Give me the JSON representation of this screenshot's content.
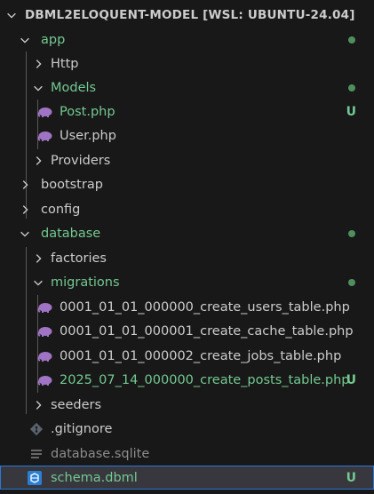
{
  "explorer": {
    "root_label": "DBML2ELOQUENT-MODEL [WSL: UBUNTU-24.04]"
  },
  "tree": {
    "app": "app",
    "http": "Http",
    "models": "Models",
    "post_php": "Post.php",
    "user_php": "User.php",
    "providers": "Providers",
    "bootstrap": "bootstrap",
    "config": "config",
    "database": "database",
    "factories": "factories",
    "migrations": "migrations",
    "mig_users": "0001_01_01_000000_create_users_table.php",
    "mig_cache": "0001_01_01_000001_create_cache_table.php",
    "mig_jobs": "0001_01_01_000002_create_jobs_table.php",
    "mig_posts": "2025_07_14_000000_create_posts_table.php",
    "seeders": "seeders",
    "gitignore": ".gitignore",
    "database_sqlite": "database.sqlite",
    "schema_dbml": "schema.dbml"
  },
  "badges": {
    "untracked": "U"
  },
  "colors": {
    "background": "#181818",
    "modified_green": "#73c991",
    "ignored_gray": "#8c8c8c",
    "php_icon": "#a074c4",
    "dbml_icon": "#2a7fd4",
    "selection": "#37373d"
  },
  "icons": {
    "php": "elephant-php-icon",
    "git": "git-diamond-icon",
    "text": "lines-file-icon",
    "dbml": "dbml-file-icon",
    "expanded": "chevron-down-icon",
    "collapsed": "chevron-right-icon"
  }
}
